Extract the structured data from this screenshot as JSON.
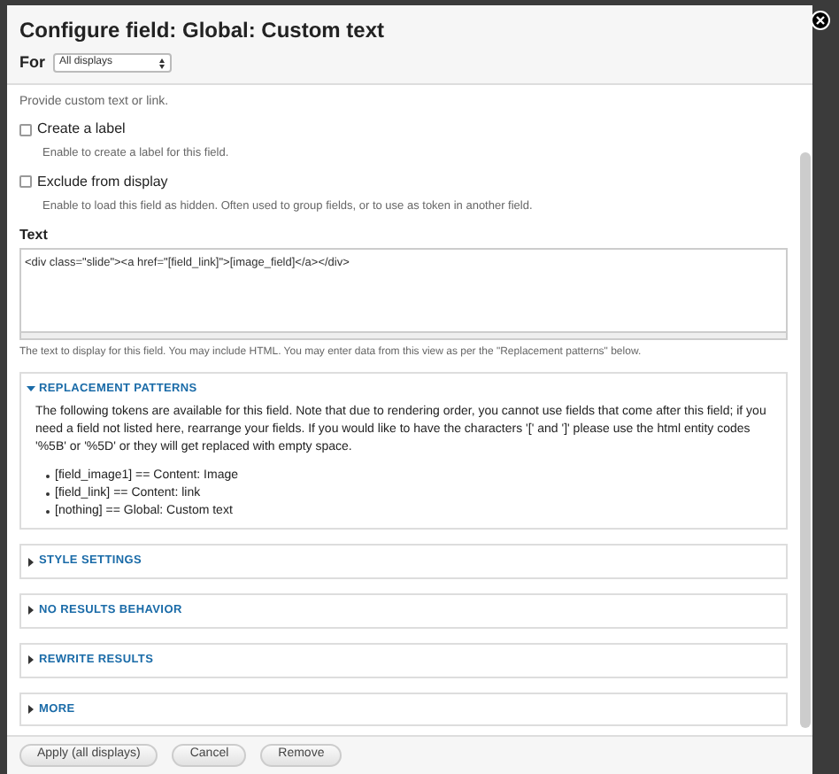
{
  "dialog": {
    "title": "Configure field: Global: Custom text",
    "for_label": "For",
    "for_select": "All displays"
  },
  "intro": "Provide custom text or link.",
  "options": [
    {
      "label": "Create a label",
      "checked": false,
      "description": "Enable to create a label for this field."
    },
    {
      "label": "Exclude from display",
      "checked": false,
      "description": "Enable to load this field as hidden. Often used to group fields, or to use as token in another field."
    }
  ],
  "text_field": {
    "label": "Text",
    "value": "<div class=\"slide\"><a href=\"[field_link]\">[image_field]</a></div>",
    "description": "The text to display for this field. You may include HTML. You may enter data from this view as per the \"Replacement patterns\" below."
  },
  "sections": [
    {
      "title": "REPLACEMENT PATTERNS",
      "expanded": true,
      "text": "The following tokens are available for this field. Note that due to rendering order, you cannot use fields that come after this field; if you need a field not listed here, rearrange your fields. If you would like to have the characters '[' and ']' please use the html entity codes '%5B' or '%5D' or they will get replaced with empty space.",
      "items": [
        "[field_image1] == Content: Image",
        "[field_link] == Content: link",
        "[nothing] == Global: Custom text"
      ]
    },
    {
      "title": "STYLE SETTINGS",
      "expanded": false
    },
    {
      "title": "NO RESULTS BEHAVIOR",
      "expanded": false
    },
    {
      "title": "REWRITE RESULTS",
      "expanded": false
    },
    {
      "title": "MORE",
      "expanded": false
    }
  ],
  "buttons": [
    "Apply (all displays)",
    "Cancel",
    "Remove"
  ]
}
